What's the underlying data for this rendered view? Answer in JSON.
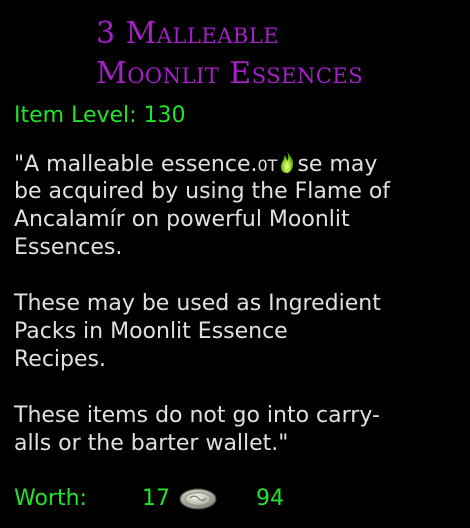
{
  "item": {
    "title_line1": "3 Malleable",
    "title_line2": "Moonlit Essences",
    "item_level_label": "Item Level:",
    "item_level_value": "130",
    "icons": {
      "inline_icon": "green-flame-icon",
      "coin_icon": "silver-coin-icon"
    },
    "colors": {
      "title": "#a61fc9",
      "stat_green": "#22e22a",
      "text": "#e0e0e0",
      "background": "#000000"
    }
  },
  "description": {
    "line1_a": "\"A malleable essence.",
    "line1_glitch": "0T",
    "line1_b": "se may",
    "line2": "be acquired by using the Flame of",
    "line3": "Ancalamír on powerful Moonlit",
    "line4": "Essences.",
    "line5": "These may be used as Ingredient",
    "line6": "Packs in Moonlit Essence",
    "line7": "Recipes.",
    "line8": "These items do not go into carry-",
    "line9": "alls or the barter wallet.\""
  },
  "worth": {
    "label": "Worth:",
    "silver": "17",
    "copper": "94"
  }
}
